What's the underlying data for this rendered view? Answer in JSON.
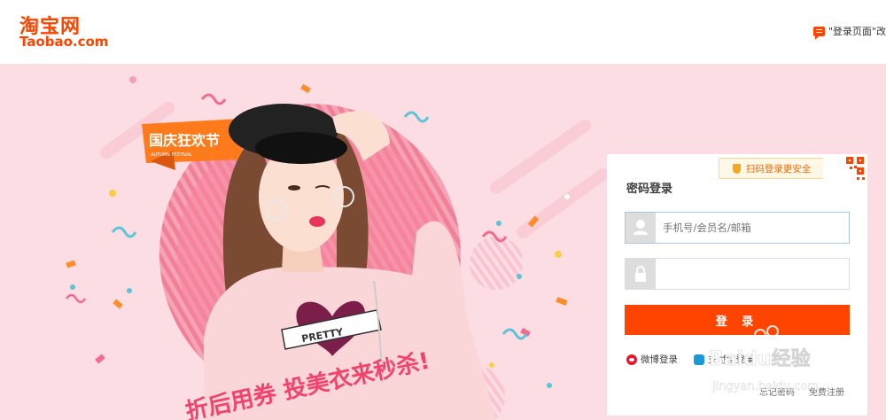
{
  "header": {
    "logo_cn": "淘宝网",
    "logo_en": "Taobao.com",
    "feedback_text": "\"登录页面\"改"
  },
  "banner": {
    "badge": "国庆狂欢节",
    "slogan": "折后用券 投美衣来秒杀!",
    "shirt_text": "PRETTY"
  },
  "login": {
    "qr_hint": "扫码登录更安全",
    "title": "密码登录",
    "username_placeholder": "手机号/会员名/邮箱",
    "password_placeholder": "",
    "submit_label": "登 录",
    "weibo_label": "微博登录",
    "alipay_label": "支付宝登录",
    "forgot_password": "忘记密码",
    "register": "免费注册"
  },
  "watermark": {
    "brand": "Baidu经验",
    "url": "jingyan.baidu.com"
  },
  "colors": {
    "brand": "#ff4400",
    "banner_bg": "#fbdde3",
    "circle": "#f2728e"
  }
}
